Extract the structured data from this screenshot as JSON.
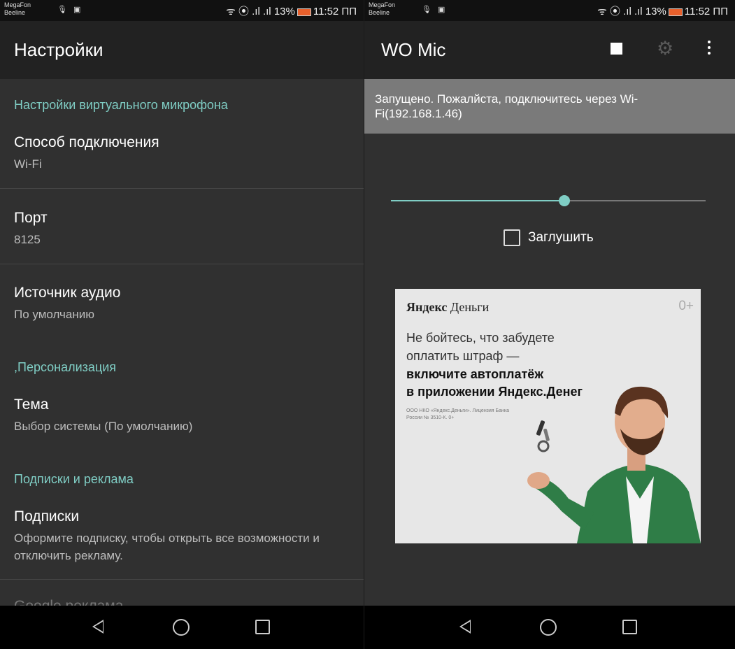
{
  "left": {
    "status_bar": {
      "carrier1": "MegaFon",
      "carrier2": "Beeline",
      "indicators": "ᯤ ⦿ .ıl .ıl",
      "battery_percent": "13%",
      "time": "11:52 ПП"
    },
    "app_bar": {
      "title": "Настройки"
    },
    "sections": [
      {
        "header": "Настройки виртуального микрофона"
      },
      {
        "header": ",Персонализация"
      },
      {
        "header": "Подписки и реклама"
      }
    ],
    "prefs": [
      {
        "title": "Способ подключения",
        "summary": "Wi-Fi"
      },
      {
        "title": "Порт",
        "summary": "8125"
      },
      {
        "title": "Источник аудио",
        "summary": "По умолчанию"
      },
      {
        "title": "Тема",
        "summary": "Выбор системы (По умолчанию)"
      },
      {
        "title": "Подписки",
        "summary": "Оформите подписку, чтобы открыть все возможности и отключить рекламу."
      },
      {
        "title": "Google реклама"
      }
    ]
  },
  "right": {
    "status_bar": {
      "carrier1": "MegaFon",
      "carrier2": "Beeline",
      "indicators": "ᯤ ⦿ .ıl .ıl",
      "battery_percent": "13%",
      "time": "11:52 ПП"
    },
    "app_bar": {
      "title": "WO Mic"
    },
    "status_message": "Запущено. Пожалйста, подключитесь через Wi-Fi(192.168.1.46)",
    "volume": {
      "level": 0.55
    },
    "mute": {
      "label": "Заглушить",
      "checked": false
    },
    "ad": {
      "brand_bold": "Яндекс",
      "brand_rest": "Деньги",
      "age_rating": "0+",
      "line1": "Не бойтесь, что забудете",
      "line2": "оплатить штраф —",
      "line3": "включите автоплатёж",
      "line4": "в приложении Яндекс.Денег",
      "legal": "ООО НКО «Яндекс.Деньги». Лицензия Банка России № 3510-К. 0+"
    }
  },
  "icons": {
    "stop": "stop-icon",
    "settings": "gear-icon",
    "overflow": "overflow-menu-icon",
    "back": "back-icon",
    "home": "home-icon",
    "recents": "recents-icon"
  },
  "colors": {
    "accent": "#7fcdc4",
    "background": "#303030",
    "app_bar": "#222222",
    "banner": "#7a7a7a"
  }
}
